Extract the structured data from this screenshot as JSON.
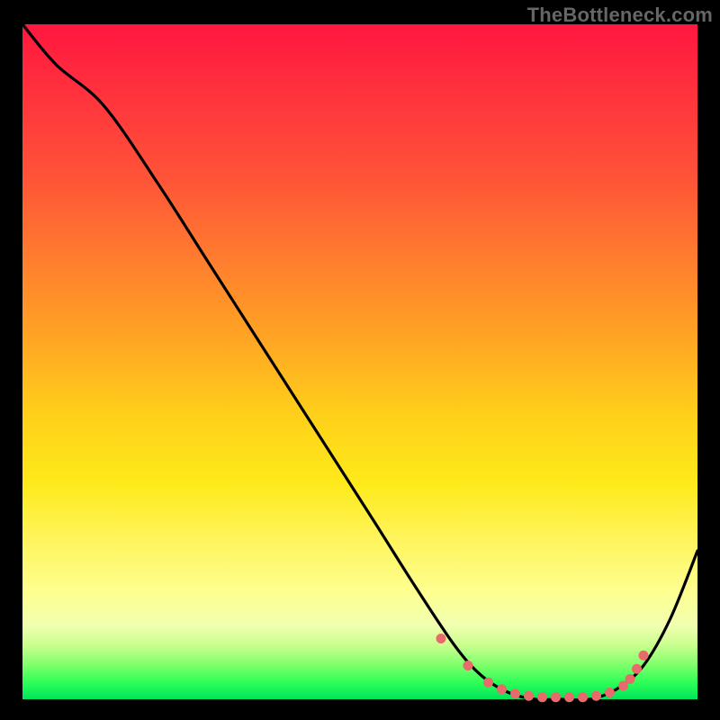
{
  "watermark": "TheBottleneck.com",
  "chart_data": {
    "type": "line",
    "title": "",
    "xlabel": "",
    "ylabel": "",
    "xlim": [
      0,
      100
    ],
    "ylim": [
      0,
      100
    ],
    "series": [
      {
        "name": "curve",
        "x": [
          0,
          5,
          12,
          20,
          28,
          36,
          44,
          52,
          58,
          64,
          68,
          72,
          76,
          80,
          84,
          88,
          92,
          96,
          100
        ],
        "values": [
          100,
          94,
          88,
          76.5,
          64,
          51.5,
          39,
          26.5,
          17,
          8,
          3.5,
          1,
          0,
          0,
          0,
          1.5,
          5,
          12,
          22
        ]
      }
    ],
    "markers": {
      "name": "bottom-dots",
      "color": "#e86a6a",
      "x": [
        62,
        66,
        69,
        71,
        73,
        75,
        77,
        79,
        81,
        83,
        85,
        87,
        89,
        90,
        91,
        92
      ],
      "values": [
        9,
        5,
        2.5,
        1.5,
        0.8,
        0.5,
        0.3,
        0.3,
        0.3,
        0.3,
        0.5,
        1.0,
        2.0,
        3.0,
        4.5,
        6.5
      ]
    },
    "gradient_stops": [
      {
        "pos": 0.0,
        "color": "#ff173f"
      },
      {
        "pos": 0.35,
        "color": "#ff7a2f"
      },
      {
        "pos": 0.65,
        "color": "#feea1a"
      },
      {
        "pos": 0.9,
        "color": "#c9ff8f"
      },
      {
        "pos": 1.0,
        "color": "#00e45a"
      }
    ]
  }
}
